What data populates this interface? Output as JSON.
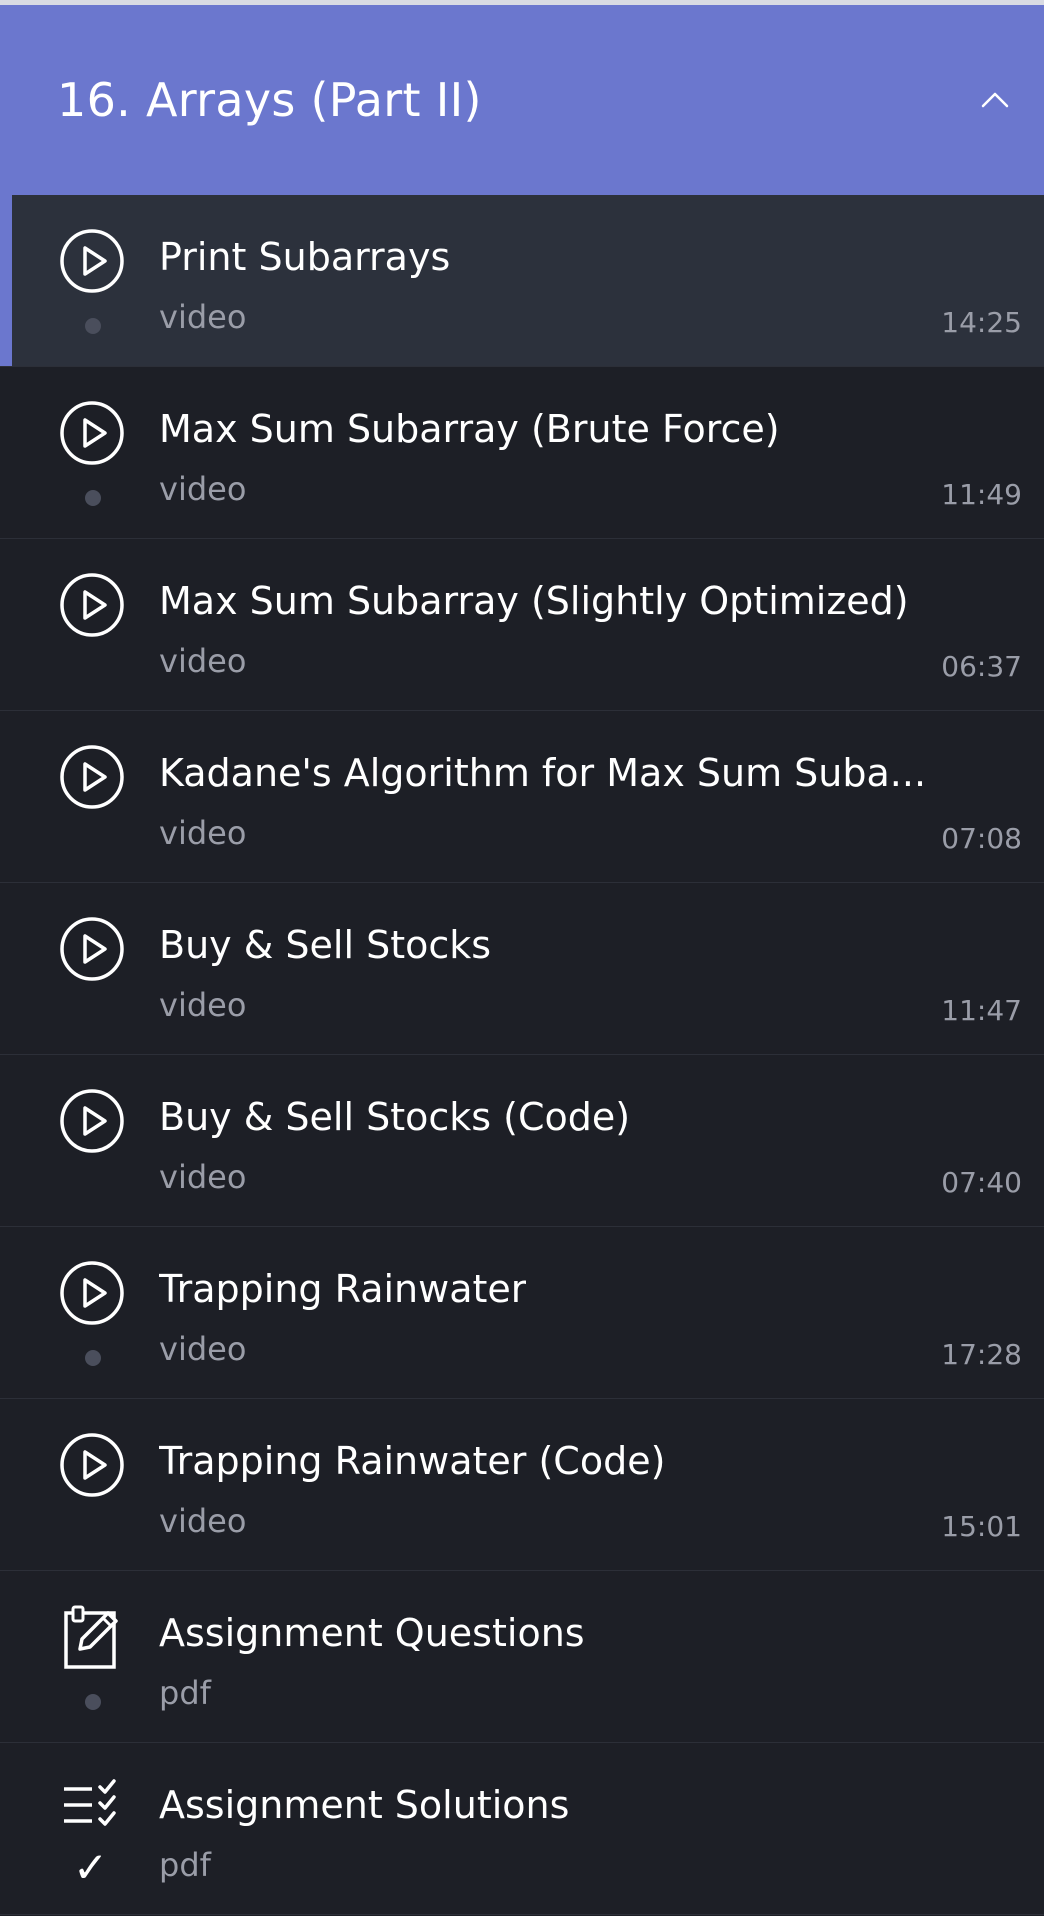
{
  "section": {
    "title": "16. Arrays (Part II)",
    "toggle_icon": "chevron-up-icon",
    "accent_color": "#6b77ce"
  },
  "items": [
    {
      "title": "Print Subarrays",
      "type": "video",
      "duration": "14:25",
      "icon": "play-circle-icon",
      "status": "dot",
      "active": true
    },
    {
      "title": "Max Sum Subarray (Brute Force)",
      "type": "video",
      "duration": "11:49",
      "icon": "play-circle-icon",
      "status": "dot",
      "active": false
    },
    {
      "title": "Max Sum Subarray (Slightly Optimized)",
      "type": "video",
      "duration": "06:37",
      "icon": "play-circle-icon",
      "status": "none",
      "active": false
    },
    {
      "title": "Kadane's Algorithm for Max Sum Suba...",
      "type": "video",
      "duration": "07:08",
      "icon": "play-circle-icon",
      "status": "none",
      "active": false
    },
    {
      "title": "Buy & Sell Stocks",
      "type": "video",
      "duration": "11:47",
      "icon": "play-circle-icon",
      "status": "none",
      "active": false
    },
    {
      "title": "Buy & Sell Stocks (Code)",
      "type": "video",
      "duration": "07:40",
      "icon": "play-circle-icon",
      "status": "none",
      "active": false
    },
    {
      "title": "Trapping Rainwater",
      "type": "video",
      "duration": "17:28",
      "icon": "play-circle-icon",
      "status": "dot",
      "active": false
    },
    {
      "title": "Trapping Rainwater (Code)",
      "type": "video",
      "duration": "15:01",
      "icon": "play-circle-icon",
      "status": "none",
      "active": false
    },
    {
      "title": "Assignment Questions",
      "type": "pdf",
      "duration": "",
      "icon": "assignment-edit-icon",
      "status": "dot",
      "active": false
    },
    {
      "title": "Assignment Solutions",
      "type": "pdf",
      "duration": "",
      "icon": "checklist-icon",
      "status": "check",
      "active": false
    }
  ]
}
